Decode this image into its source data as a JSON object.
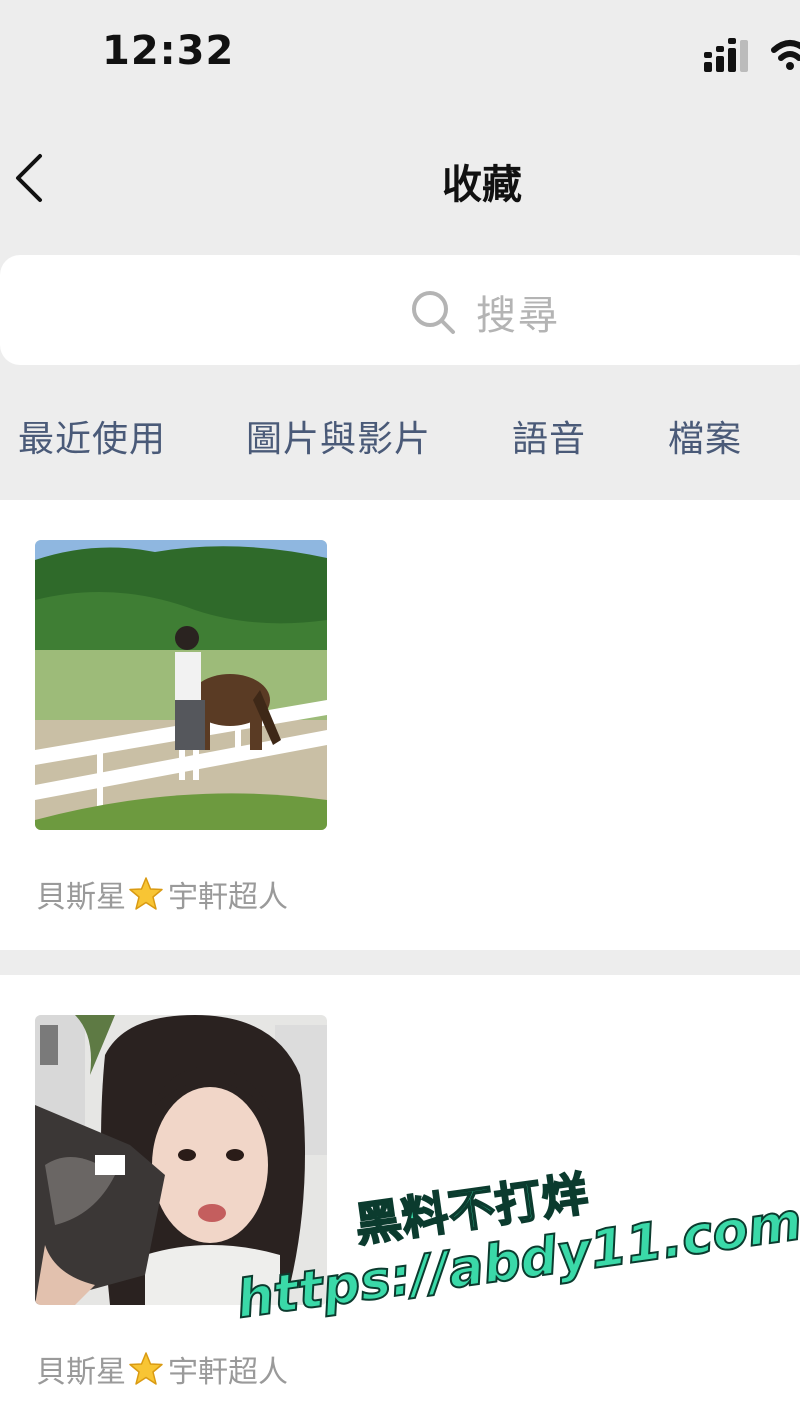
{
  "status_bar": {
    "time": "12:32"
  },
  "nav": {
    "title": "收藏"
  },
  "search": {
    "placeholder": "搜尋"
  },
  "tabs": [
    {
      "label": "最近使用"
    },
    {
      "label": "圖片與影片"
    },
    {
      "label": "語音"
    },
    {
      "label": "檔案"
    }
  ],
  "items": [
    {
      "source_before": "貝斯星",
      "source_after": "宇軒超人",
      "icon": "star-emoji-icon"
    },
    {
      "source_before": "貝斯星",
      "source_after": "宇軒超人",
      "icon": "star-emoji-icon"
    }
  ],
  "watermark": {
    "line1": "黑料不打烊",
    "line2": "https://abdy11.com"
  },
  "colors": {
    "background": "#ededed",
    "tab_text": "#4a5a78",
    "watermark": "#3ad9a8"
  }
}
